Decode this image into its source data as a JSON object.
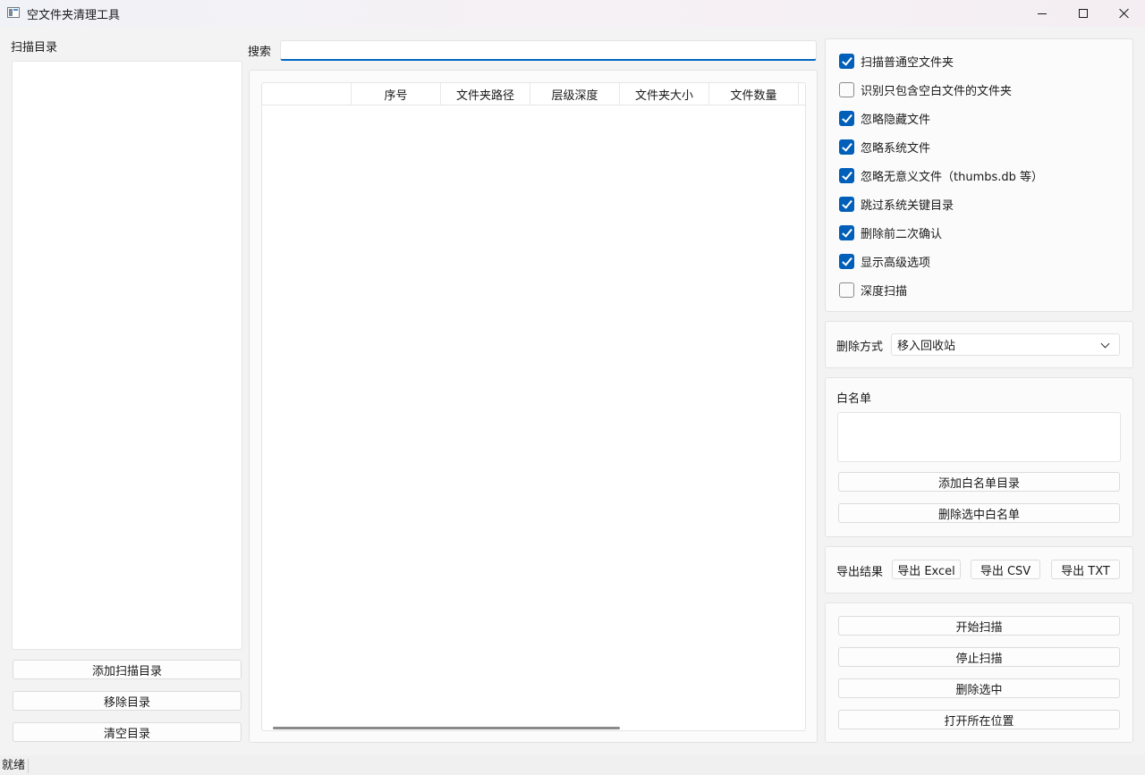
{
  "window": {
    "title": "空文件夹清理工具"
  },
  "left": {
    "label": "扫描目录",
    "buttons": [
      "添加扫描目录",
      "移除目录",
      "清空目录"
    ]
  },
  "search": {
    "label": "搜索",
    "value": ""
  },
  "table": {
    "columns": [
      "",
      "序号",
      "文件夹路径",
      "层级深度",
      "文件夹大小",
      "文件数量"
    ]
  },
  "options": [
    {
      "label": "扫描普通空文件夹",
      "checked": true
    },
    {
      "label": "识别只包含空白文件的文件夹",
      "checked": false
    },
    {
      "label": "忽略隐藏文件",
      "checked": true
    },
    {
      "label": "忽略系统文件",
      "checked": true
    },
    {
      "label": "忽略无意义文件（thumbs.db 等）",
      "checked": true
    },
    {
      "label": "跳过系统关键目录",
      "checked": true
    },
    {
      "label": "删除前二次确认",
      "checked": true
    },
    {
      "label": "显示高级选项",
      "checked": true
    },
    {
      "label": "深度扫描",
      "checked": false
    }
  ],
  "delete_mode": {
    "label": "删除方式",
    "value": "移入回收站"
  },
  "whitelist": {
    "label": "白名单",
    "add": "添加白名单目录",
    "remove": "删除选中白名单"
  },
  "export": {
    "label": "导出结果",
    "excel": "导出 Excel",
    "csv": "导出 CSV",
    "txt": "导出 TXT"
  },
  "actions": [
    "开始扫描",
    "停止扫描",
    "删除选中",
    "打开所在位置"
  ],
  "status": {
    "text": "就绪"
  },
  "colors": {
    "accent": "#005fb8"
  }
}
